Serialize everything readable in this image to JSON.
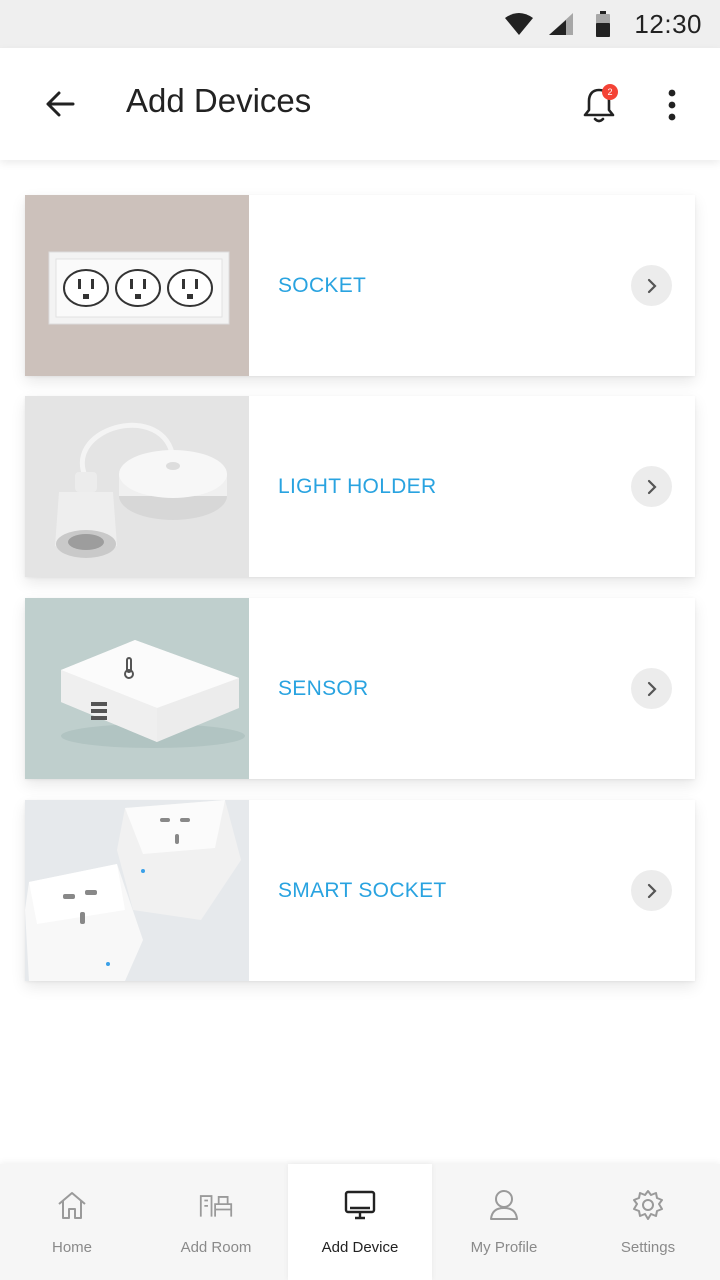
{
  "status_bar": {
    "time": "12:30"
  },
  "app_bar": {
    "title": "Add Devices",
    "notification_count": "2"
  },
  "devices": [
    {
      "label": "SOCKET"
    },
    {
      "label": "LIGHT HOLDER"
    },
    {
      "label": "SENSOR"
    },
    {
      "label": "SMART SOCKET"
    }
  ],
  "bottom_nav": [
    {
      "label": "Home",
      "icon": "home-icon"
    },
    {
      "label": "Add Room",
      "icon": "room-icon"
    },
    {
      "label": "Add Device",
      "icon": "device-icon",
      "active": true
    },
    {
      "label": "My Profile",
      "icon": "profile-icon"
    },
    {
      "label": "Settings",
      "icon": "gear-icon"
    }
  ],
  "colors": {
    "accent": "#29a3e0",
    "badge": "#f44336",
    "status_bar": "#efefef"
  }
}
